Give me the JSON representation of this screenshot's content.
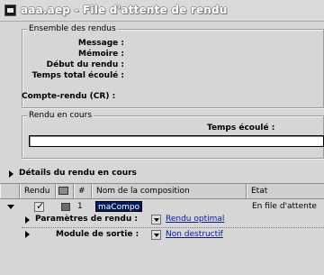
{
  "window": {
    "title": "aaa.aep - File d'attente de rendu"
  },
  "render_set": {
    "legend": "Ensemble des rendus",
    "message_label": "Message :",
    "memory_label": "Mémoire :",
    "start_label": "Début du rendu :",
    "elapsed_total_label": "Temps total écoulé :",
    "log_label": "Compte-rendu (CR) :"
  },
  "current_render": {
    "legend": "Rendu en cours",
    "elapsed_label": "Temps écoulé :"
  },
  "details": {
    "label": "Détails du rendu en cours"
  },
  "columns": [
    "Rendu",
    "#",
    "Nom de la composition",
    "Etat"
  ],
  "queue": {
    "number": "1",
    "comp_name": "maCompo",
    "status": "En file d'attente",
    "render_settings_label": "Paramètres de rendu :",
    "render_settings_value": "Rendu optimal",
    "output_module_label": "Module de sortie :",
    "output_module_value": "Non destructif"
  }
}
